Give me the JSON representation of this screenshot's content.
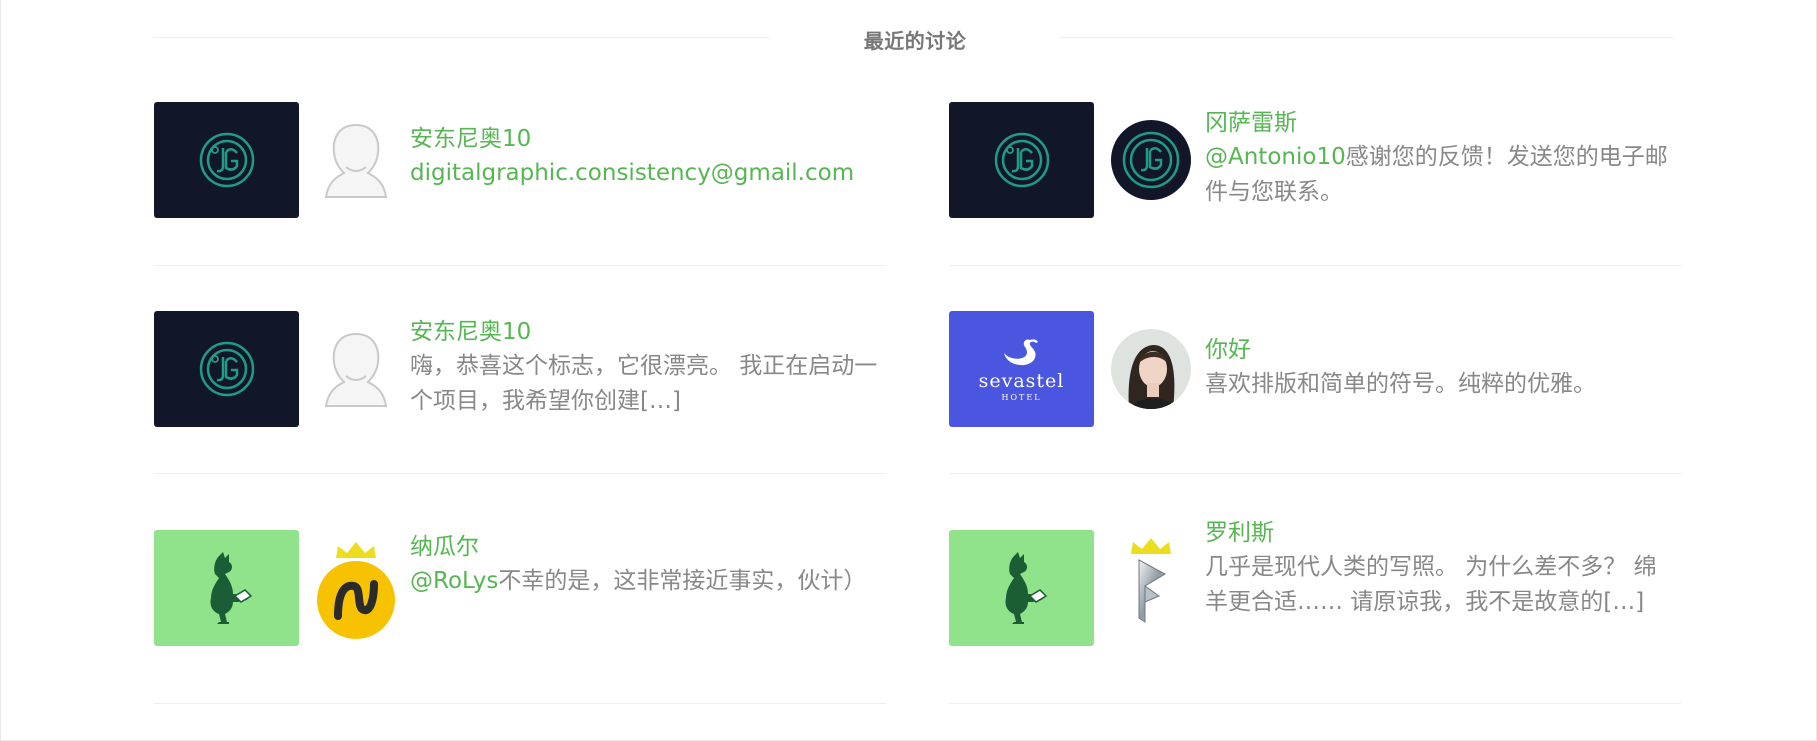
{
  "section": {
    "title": "最近的讨论"
  },
  "items": [
    {
      "author": "安东尼奥10",
      "mention": "",
      "text": "digitalgraphic.consistency@gmail.com"
    },
    {
      "author": "冈萨雷斯",
      "mention": "@Antonio10",
      "text": "感谢您的反馈！发送您的电子邮件与您联系。"
    },
    {
      "author": "安东尼奥10",
      "mention": "",
      "text": "嗨，恭喜这个标志，它很漂亮。 我正在启动一个项目，我希望你创建[…]"
    },
    {
      "author": "你好",
      "mention": "",
      "text": "喜欢排版和简单的符号。纯粹的优雅。"
    },
    {
      "author": "纳瓜尔",
      "mention": "@RoLys",
      "text": "不幸的是，这非常接近事实，伙计）"
    },
    {
      "author": "罗利斯",
      "mention": "",
      "text": "几乎是现代人类的写照。 为什么差不多？ 绵羊更合适…… 请原谅我，我不是故意的[…]"
    }
  ],
  "thumbs": {
    "hotel_brand": "sevastel",
    "hotel_sub": "HOTEL"
  },
  "colors": {
    "accent_green": "#56b652",
    "navy": "#111629",
    "teal": "#1f9d84",
    "hotel_blue": "#4a56e0",
    "mint": "#90e28b",
    "yellow": "#f2c200"
  }
}
